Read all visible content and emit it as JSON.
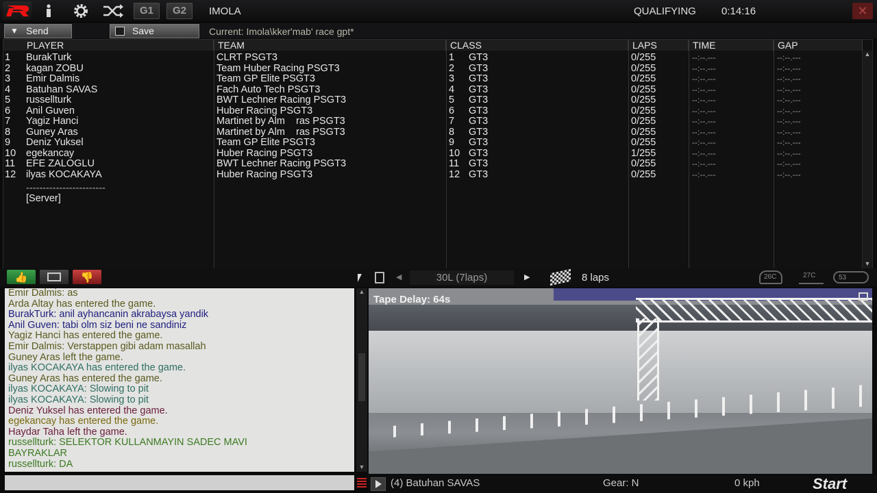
{
  "topbar": {
    "track": "IMOLA",
    "session": "QUALIFYING",
    "clock": "0:14:16",
    "g1": "G1",
    "g2": "G2",
    "icons": [
      "logo-r-icon",
      "info-icon",
      "gear-icon",
      "shuffle-icon",
      "close-icon"
    ]
  },
  "toolbar": {
    "send_label": "Send",
    "save_label": "Save",
    "current": "Current: Imola\\kker'mab' race gpt*"
  },
  "grid": {
    "headers": [
      "PLAYER",
      "TEAM",
      "CLASS",
      "LAPS",
      "TIME",
      "GAP"
    ],
    "rows": [
      {
        "pos": "1",
        "player": "BurakTurk",
        "team": "CLRT PSGT3",
        "cls_pos": "1",
        "cls": "GT3",
        "laps": "0/255",
        "time": "--:--.---",
        "gap": "--:--.---"
      },
      {
        "pos": "2",
        "player": "kagan ZOBU",
        "team": "Team Huber Racing PSGT3",
        "cls_pos": "2",
        "cls": "GT3",
        "laps": "0/255",
        "time": "--:--.---",
        "gap": "--:--.---"
      },
      {
        "pos": "3",
        "player": "Emir Dalmis",
        "team": "Team GP Elite PSGT3",
        "cls_pos": "3",
        "cls": "GT3",
        "laps": "0/255",
        "time": "--:--.---",
        "gap": "--:--.---"
      },
      {
        "pos": "4",
        "player": "Batuhan SAVAS",
        "team": "Fach Auto Tech PSGT3",
        "cls_pos": "4",
        "cls": "GT3",
        "laps": "0/255",
        "time": "--:--.---",
        "gap": "--:--.---"
      },
      {
        "pos": "5",
        "player": "russellturk",
        "team": "BWT Lechner Racing PSGT3",
        "cls_pos": "5",
        "cls": "GT3",
        "laps": "0/255",
        "time": "--:--.---",
        "gap": "--:--.---"
      },
      {
        "pos": "6",
        "player": "Anil Guven",
        "team": "Huber Racing PSGT3",
        "cls_pos": "6",
        "cls": "GT3",
        "laps": "0/255",
        "time": "--:--.---",
        "gap": "--:--.---"
      },
      {
        "pos": "7",
        "player": "Yagiz Hanci",
        "team": "Martinet by Alm    ras PSGT3",
        "cls_pos": "7",
        "cls": "GT3",
        "laps": "0/255",
        "time": "--:--.---",
        "gap": "--:--.---"
      },
      {
        "pos": "8",
        "player": "Guney Aras",
        "team": "Martinet by Alm    ras PSGT3",
        "cls_pos": "8",
        "cls": "GT3",
        "laps": "0/255",
        "time": "--:--.---",
        "gap": "--:--.---"
      },
      {
        "pos": "9",
        "player": "Deniz Yuksel",
        "team": "Team GP Elite PSGT3",
        "cls_pos": "9",
        "cls": "GT3",
        "laps": "0/255",
        "time": "--:--.---",
        "gap": "--:--.---"
      },
      {
        "pos": "10",
        "player": "egekancay",
        "team": "Huber Racing PSGT3",
        "cls_pos": "10",
        "cls": "GT3",
        "laps": "1/255",
        "time": "--:--.---",
        "gap": "--:--.---"
      },
      {
        "pos": "11",
        "player": "EFE ZALOGLU",
        "team": "BWT Lechner Racing PSGT3",
        "cls_pos": "11",
        "cls": "GT3",
        "laps": "0/255",
        "time": "--:--.---",
        "gap": "--:--.---"
      },
      {
        "pos": "12",
        "player": "ilyas KOCAKAYA",
        "team": "Huber Racing PSGT3",
        "cls_pos": "12",
        "cls": "GT3",
        "laps": "0/255",
        "time": "--:--.---",
        "gap": "--:--.---"
      }
    ],
    "separator": "------------------------",
    "server": "[Server]"
  },
  "controls": {
    "fuel_label": "30L (7laps)",
    "race_laps": "8 laps",
    "ambient_temp": "26C",
    "track_temp": "27C",
    "other_temp": "53"
  },
  "chat": [
    {
      "text": "Emir Dalmis: as",
      "color": "#5a5a20"
    },
    {
      "text": "Arda Altay has entered the game.",
      "color": "#5a5a20"
    },
    {
      "text": "BurakTurk: anil ayhancanin akrabaysa yandik",
      "color": "#202080"
    },
    {
      "text": "Anil Guven: tabi olm siz beni ne sandiniz",
      "color": "#202080"
    },
    {
      "text": "Yagiz Hanci has entered the game.",
      "color": "#5a5a20"
    },
    {
      "text": "Emir Dalmis: Verstappen gibi adam masallah",
      "color": "#5a5a20"
    },
    {
      "text": "Guney Aras left the game.",
      "color": "#5a5a20"
    },
    {
      "text": "ilyas KOCAKAYA has entered the game.",
      "color": "#2d6e62"
    },
    {
      "text": "Guney Aras has entered the game.",
      "color": "#5a5a20"
    },
    {
      "text": "ilyas KOCAKAYA: Slowing to pit",
      "color": "#2d6e62"
    },
    {
      "text": "ilyas KOCAKAYA: Slowing to pit",
      "color": "#2d6e62"
    },
    {
      "text": "Deniz Yuksel has entered the game.",
      "color": "#6a1e3c"
    },
    {
      "text": "egekancay has entered the game.",
      "color": "#7a6a10"
    },
    {
      "text": "Haydar Taha left the game.",
      "color": "#6a1e3c"
    },
    {
      "text": "russellturk: SELEKTOR KULLANMAYIN SADEC MAVI",
      "color": "#3c7a22"
    },
    {
      "text": "BAYRAKLAR",
      "color": "#3c7a22"
    },
    {
      "text": "russellturk: DA",
      "color": "#3c7a22"
    }
  ],
  "view": {
    "tape_delay": "Tape Delay: 64s"
  },
  "bottombar": {
    "driver": "(4) Batuhan SAVAS",
    "gear": "Gear: N",
    "speed": "0 kph",
    "start_label": "Start"
  }
}
